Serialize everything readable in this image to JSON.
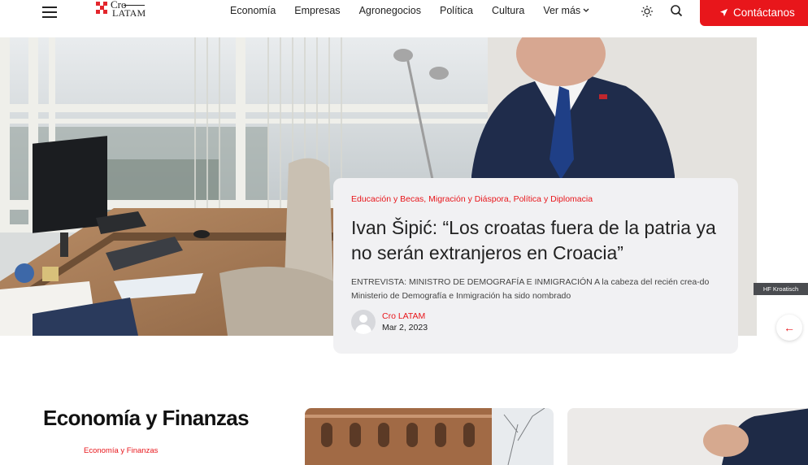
{
  "header": {
    "logo": {
      "line1": "Cro",
      "line2": "LATAM"
    },
    "nav": [
      {
        "label": "Economía",
        "name": "nav-economia"
      },
      {
        "label": "Empresas",
        "name": "nav-empresas"
      },
      {
        "label": "Agronegocios",
        "name": "nav-agronegocios"
      },
      {
        "label": "Política",
        "name": "nav-politica"
      },
      {
        "label": "Cultura",
        "name": "nav-cultura"
      }
    ],
    "more_label": "Ver más",
    "contact_label": "Contáctanos"
  },
  "hero": {
    "photo_credit": "HF Kroatisch",
    "categories": "Educación y Becas, Migración y Diáspora, Política y Diplomacia",
    "title": "Ivan Šipić: “Los croatas fuera de la patria ya no serán extranjeros en Croacia”",
    "excerpt": "ENTREVISTA: MINISTRO DE DEMOGRAFÍA E INMIGRACIÓN A la cabeza del recién crea-do Ministerio de Demografía e Inmigración ha sido nombrado",
    "author": "Cro LATAM",
    "date": "Mar 2, 2023"
  },
  "section": {
    "title": "Economía y Finanzas",
    "category_label": "Economía y Finanzas"
  },
  "icons": {
    "menu": "menu-icon",
    "theme": "sun-icon",
    "search": "search-icon",
    "contact": "send-icon",
    "prev": "arrow-left-icon"
  },
  "colors": {
    "accent": "#e8161b",
    "card_bg": "#f1f1f3"
  }
}
